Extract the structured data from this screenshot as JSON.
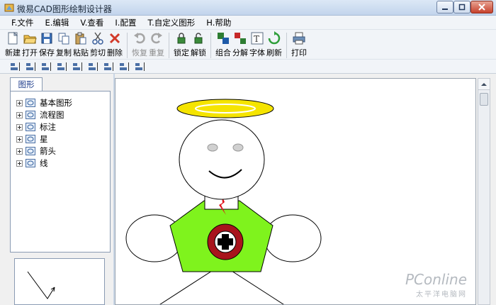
{
  "window": {
    "title": "微易CAD图形绘制设计器"
  },
  "menu": [
    "F.文件",
    "E.编辑",
    "V.查看",
    "I.配置",
    "T.自定义图形",
    "H.帮助"
  ],
  "toolbar": [
    {
      "label": "新建",
      "icon": "new-file-icon",
      "enabled": true
    },
    {
      "label": "打开",
      "icon": "open-folder-icon",
      "enabled": true
    },
    {
      "label": "保存",
      "icon": "save-icon",
      "enabled": true
    },
    {
      "label": "复制",
      "icon": "copy-icon",
      "enabled": true
    },
    {
      "label": "粘贴",
      "icon": "paste-icon",
      "enabled": true
    },
    {
      "label": "剪切",
      "icon": "cut-icon",
      "enabled": true
    },
    {
      "label": "删除",
      "icon": "delete-icon",
      "enabled": true
    },
    {
      "sep": true
    },
    {
      "label": "恢复",
      "icon": "undo-icon",
      "enabled": false
    },
    {
      "label": "重复",
      "icon": "redo-icon",
      "enabled": false
    },
    {
      "sep": true
    },
    {
      "label": "锁定",
      "icon": "lock-icon",
      "enabled": true
    },
    {
      "label": "解锁",
      "icon": "unlock-icon",
      "enabled": true
    },
    {
      "sep": true
    },
    {
      "label": "组合",
      "icon": "group-icon",
      "enabled": true
    },
    {
      "label": "分解",
      "icon": "ungroup-icon",
      "enabled": true
    },
    {
      "label": "字体",
      "icon": "font-icon",
      "enabled": true
    },
    {
      "label": "刷新",
      "icon": "refresh-icon",
      "enabled": true
    },
    {
      "sep": true
    },
    {
      "label": "打印",
      "icon": "print-icon",
      "enabled": true
    }
  ],
  "align_toolbar": [
    "align-left-icon",
    "align-center-icon",
    "align-right-icon",
    "align-bottom-icon",
    "same-width-icon",
    "same-height-icon",
    "same-size-icon",
    "center-horizontal-icon",
    "center-vertical-icon"
  ],
  "left_panel": {
    "tab": "图形",
    "tree": [
      "基本图形",
      "流程图",
      "标注",
      "星",
      "箭头",
      "线"
    ]
  },
  "colors": {
    "halo": "#f5e400",
    "shirt": "#7ff31d",
    "badge_ring": "#a8141c",
    "tie": "#e0141c",
    "accent_tab_text": "#1f3e8c"
  },
  "watermark": {
    "main": "PConline",
    "sub": "太平洋电脑网"
  }
}
